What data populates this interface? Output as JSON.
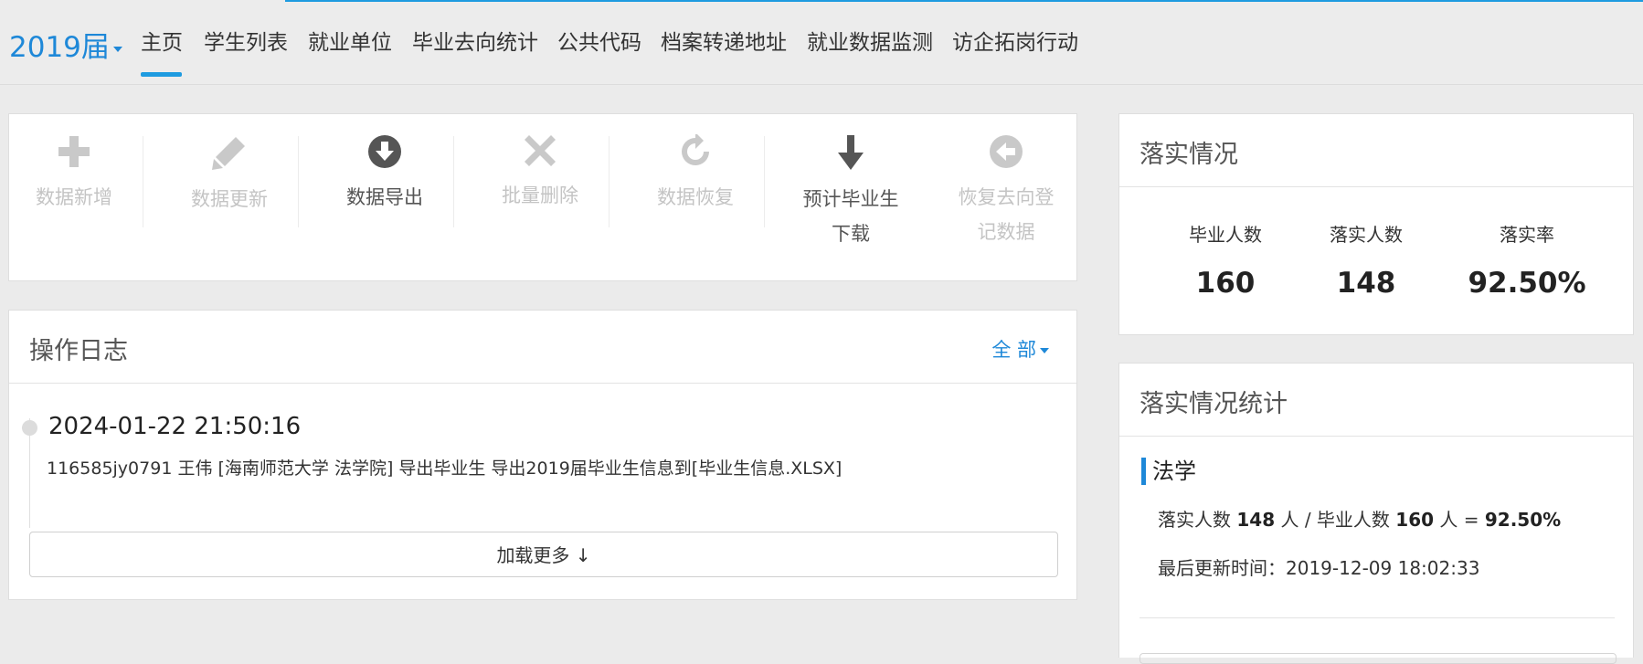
{
  "header": {
    "cohort": "2019届",
    "nav": [
      "主页",
      "学生列表",
      "就业单位",
      "毕业去向统计",
      "公共代码",
      "档案转递地址",
      "就业数据监测",
      "访企拓岗行动"
    ]
  },
  "colors": {
    "accent": "#1e88d8",
    "active_underline": "#1e9be0"
  },
  "toolbar": {
    "items": [
      {
        "label": "数据新增",
        "icon": "plus-icon",
        "state": "disabled"
      },
      {
        "label": "数据更新",
        "icon": "pencil-icon",
        "state": "disabled"
      },
      {
        "label": "数据导出",
        "icon": "download-circle-icon",
        "state": "enabled"
      },
      {
        "label": "批量删除",
        "icon": "x-icon",
        "state": "disabled"
      },
      {
        "label": "数据恢复",
        "icon": "refresh-icon",
        "state": "disabled"
      },
      {
        "label": "预计毕业生下载",
        "icon": "arrow-down-icon",
        "state": "enabled"
      },
      {
        "label": "恢复去向登记数据",
        "icon": "arrow-left-circle-icon",
        "state": "disabled"
      }
    ]
  },
  "log": {
    "title": "操作日志",
    "filter": "全 部",
    "entries": [
      {
        "time": "2024-01-22 21:50:16",
        "message": "116585jy0791 王伟 [海南师范大学 法学院] 导出毕业生 导出2019届毕业生信息到[毕业生信息.XLSX]"
      }
    ],
    "load_more": "加载更多 ↓"
  },
  "summary": {
    "title": "落实情况",
    "stats": [
      {
        "label": "毕业人数",
        "value": "160"
      },
      {
        "label": "落实人数",
        "value": "148"
      },
      {
        "label": "落实率",
        "value": "92.50%"
      }
    ]
  },
  "detail": {
    "title": "落实情况统计",
    "major": "法学",
    "ratio": {
      "t1": "落实人数 ",
      "n1": "148",
      "t2": " 人 / 毕业人数 ",
      "n2": "160",
      "t3": " 人 = ",
      "rate": "92.50%"
    },
    "updated_label": "最后更新时间：",
    "updated_value": "2019-12-09 18:02:33"
  }
}
